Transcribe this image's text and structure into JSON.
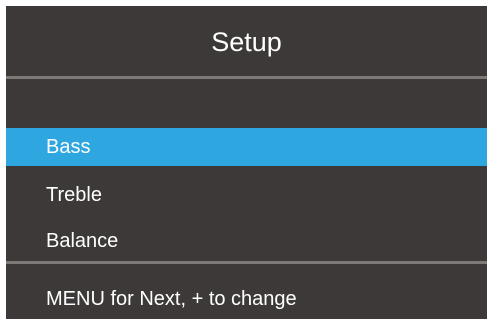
{
  "screen": {
    "title": "Setup",
    "background_color": "#3d3938",
    "accent_color": "#2ea7e0",
    "divider_color": "#7d7977"
  },
  "menu": {
    "items": [
      {
        "label": "Bass",
        "selected": true
      },
      {
        "label": "Treble",
        "selected": false
      },
      {
        "label": "Balance",
        "selected": false
      }
    ]
  },
  "footer": {
    "hint": "MENU for Next, + to change"
  }
}
